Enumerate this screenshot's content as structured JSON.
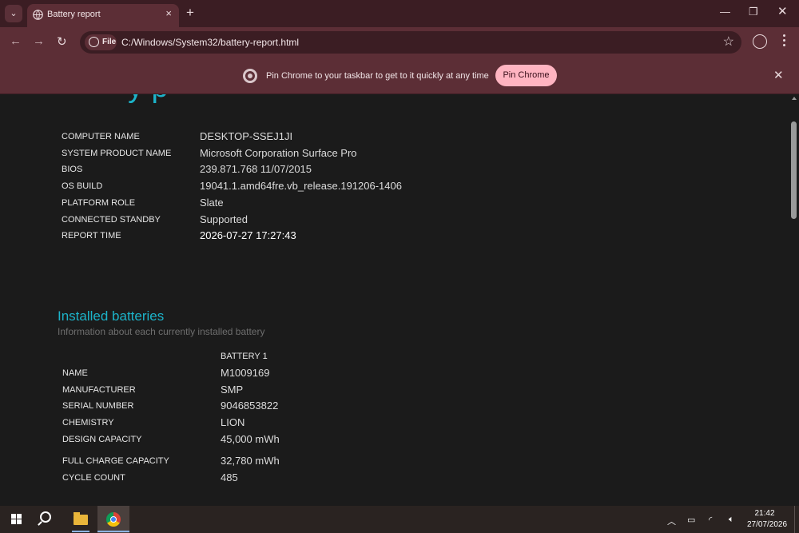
{
  "browser": {
    "tab_title": "Battery report",
    "new_tab_icon": "plus-icon",
    "close_tab_icon": "close-icon",
    "url_chip": "File",
    "url": "C:/Windows/System32/battery-report.html"
  },
  "infobar": {
    "message": "Pin Chrome to your taskbar to get to it quickly at any time",
    "button_label": "Pin Chrome"
  },
  "system_info": [
    {
      "label": "COMPUTER NAME",
      "value": "DESKTOP-SSEJ1JI"
    },
    {
      "label": "SYSTEM PRODUCT NAME",
      "value": "Microsoft Corporation Surface Pro"
    },
    {
      "label": "BIOS",
      "value": "239.871.768 11/07/2015"
    },
    {
      "label": "OS BUILD",
      "value": "19041.1.amd64fre.vb_release.191206-1406"
    },
    {
      "label": "PLATFORM ROLE",
      "value": "Slate"
    },
    {
      "label": "CONNECTED STANDBY",
      "value": "Supported"
    },
    {
      "label": "REPORT TIME",
      "value": "2026-07-27  17:27:43"
    }
  ],
  "installed_batteries": {
    "title": "Installed batteries",
    "subtitle": "Information about each currently installed battery",
    "column_header": "BATTERY 1",
    "rows": [
      {
        "label": "NAME",
        "value": "M1009169"
      },
      {
        "label": "MANUFACTURER",
        "value": "SMP"
      },
      {
        "label": "SERIAL NUMBER",
        "value": "9046853822"
      },
      {
        "label": "CHEMISTRY",
        "value": "LION"
      },
      {
        "label": "DESIGN CAPACITY",
        "value": "45,000 mWh"
      },
      {
        "label": "FULL CHARGE CAPACITY",
        "value": "32,780 mWh"
      },
      {
        "label": "CYCLE COUNT",
        "value": "485"
      }
    ]
  },
  "taskbar": {
    "time": "21:42",
    "date": "27/07/2026"
  }
}
